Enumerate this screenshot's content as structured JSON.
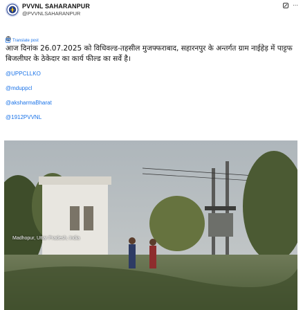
{
  "post": {
    "author_name": "PVVNL SAHARANPUR",
    "author_handle": "@PVVNLSAHARANPUR",
    "translate_label": "Translate post",
    "body": "आज दिनांक 26.07.2025 को विधिवल्ड-तहसील मुजफ्फराबाद, सहारनपुर के अन्तर्गत ग्राम नाईहेड़ में पाट्टफ बिजलीघर के ठेकेदार का कार्य फील्ड का सर्वे है।",
    "mentions": [
      "@UPPCLLKO",
      "@mduppcl",
      "@aksharmaBharat",
      "@1912PVVNL"
    ]
  },
  "photo": {
    "location_text": "Madhopur, Uttar Pradesh, India"
  },
  "colors": {
    "link": "#1a73e8",
    "text": "#111111"
  },
  "icons": {
    "avatar": "logo-avatar",
    "header_1": "grok-icon",
    "header_2": "more-icon",
    "language": "language-icon",
    "translate": "translate-icon"
  }
}
